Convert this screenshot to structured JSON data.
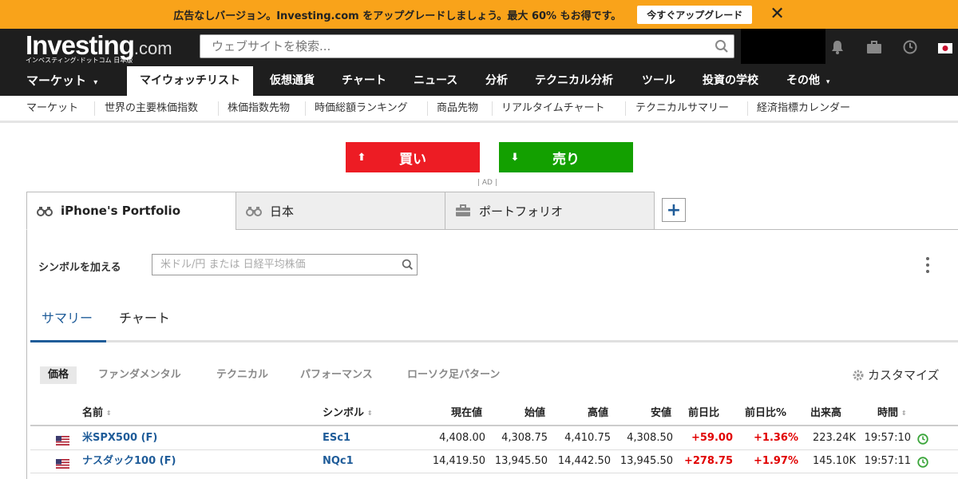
{
  "promo": {
    "text": "広告なしバージョン。Investing.com をアップグレードしましょう。最大 60% もお得です。",
    "button": "今すぐアップグレード",
    "close": "✕"
  },
  "header": {
    "logo_main": "Investing",
    "logo_com": ".com",
    "logo_sub": "インベスティング･ドットコム 日本版",
    "search_placeholder": "ウェブサイトを検索..."
  },
  "nav": {
    "items": [
      "マーケット",
      "マイウォッチリスト",
      "仮想通貨",
      "チャート",
      "ニュース",
      "分析",
      "テクニカル分析",
      "ツール",
      "投資の学校",
      "その他"
    ]
  },
  "subnav": {
    "items": [
      "マーケット",
      "世界の主要株価指数",
      "株価指数先物",
      "時価総額ランキング",
      "商品先物",
      "リアルタイムチャート",
      "テクニカルサマリー",
      "経済指標カレンダー"
    ]
  },
  "trade": {
    "buy": "買い",
    "sell": "売り",
    "ad": "| AD |"
  },
  "portfolio_tabs": [
    "iPhone's Portfolio",
    "日本",
    "ポートフォリオ"
  ],
  "add_tab": "+",
  "add_symbol": {
    "label": "シンボルを加える",
    "placeholder": "米ドル/円 または 日経平均株価"
  },
  "view_tabs": [
    "サマリー",
    "チャート"
  ],
  "filters": [
    "価格",
    "ファンダメンタル",
    "テクニカル",
    "パフォーマンス",
    "ローソク足パターン"
  ],
  "customize": "カスタマイズ",
  "table": {
    "headers": [
      "名前",
      "シンボル",
      "現在値",
      "始値",
      "高値",
      "安値",
      "前日比",
      "前日比%",
      "出来高",
      "時間"
    ],
    "rows": [
      {
        "name": "米SPX500 (F)",
        "symbol": "ESc1",
        "last": "4,408.00",
        "open": "4,308.75",
        "high": "4,410.75",
        "low": "4,308.50",
        "chg": "+59.00",
        "chg_pct": "+1.36%",
        "vol": "223.24K",
        "time": "19:57:10"
      },
      {
        "name": "ナスダック100 (F)",
        "symbol": "NQc1",
        "last": "14,419.50",
        "open": "13,945.50",
        "high": "14,442.50",
        "low": "13,945.50",
        "chg": "+278.75",
        "chg_pct": "+1.97%",
        "vol": "145.10K",
        "time": "19:57:11"
      }
    ]
  },
  "colors": {
    "promo": "#f9a31a",
    "header": "#1e1e1e",
    "buy": "#ed1c24",
    "sell": "#13a000",
    "link": "#1f5c99",
    "up": "#e10000"
  }
}
